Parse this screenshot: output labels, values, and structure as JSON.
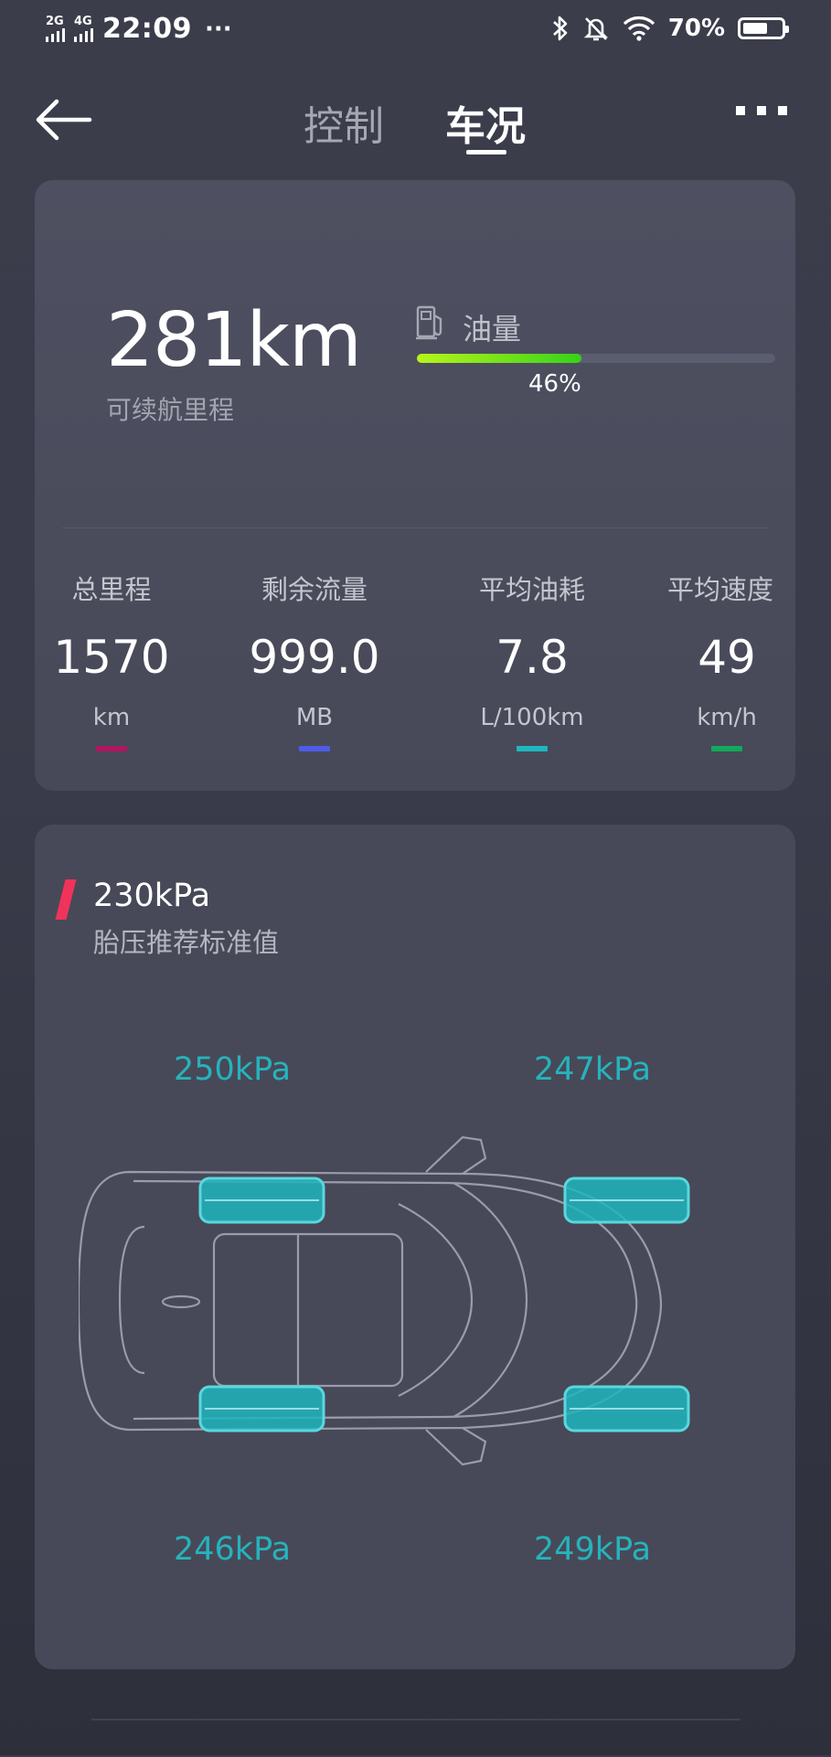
{
  "status_bar": {
    "sim1_label": "2G",
    "sim2_label": "4G",
    "time": "22:09",
    "more_dots": "···",
    "battery_percent": "70%",
    "battery_level": 0.7
  },
  "nav": {
    "tabs": [
      {
        "label": "控制",
        "active": false
      },
      {
        "label": "车况",
        "active": true
      }
    ]
  },
  "overview": {
    "range_value": "281km",
    "range_label": "可续航里程",
    "fuel_label": "油量",
    "fuel_percent_text": "46%",
    "fuel_fraction": 0.46
  },
  "stats": [
    {
      "label": "总里程",
      "value": "1570",
      "unit": "km",
      "color": "#b0175e"
    },
    {
      "label": "剩余流量",
      "value": "999.0",
      "unit": "MB",
      "color": "#4e5be8"
    },
    {
      "label": "平均油耗",
      "value": "7.8",
      "unit": "L/100km",
      "color": "#1fb6bf"
    },
    {
      "label": "平均速度",
      "value": "49",
      "unit": "km/h",
      "color": "#12a85e"
    }
  ],
  "tire_pressure": {
    "recommended_value": "230kPa",
    "recommended_label": "胎压推荐标准值",
    "front_left": "250kPa",
    "front_right": "247kPa",
    "rear_left": "246kPa",
    "rear_right": "249kPa"
  },
  "colors": {
    "accent_red": "#f0335a",
    "tire_cyan": "#26b3bb",
    "fuel_green": "#36d21a"
  }
}
